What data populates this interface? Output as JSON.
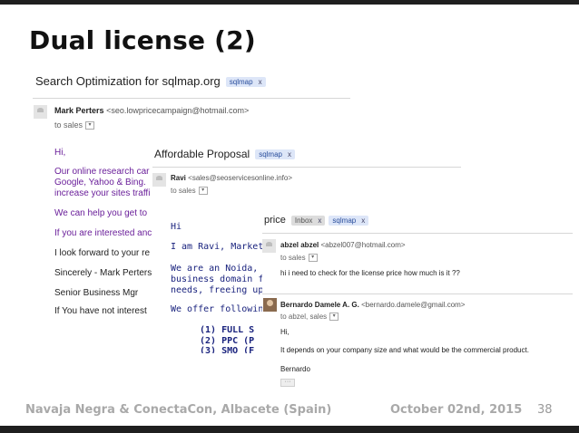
{
  "slide": {
    "title": "Dual license (2)",
    "footer_left": "Navaja Negra & ConectaCon, Albacete (Spain)",
    "footer_date": "October 02nd, 2015",
    "page_number": "38"
  },
  "email1": {
    "subject": "Search Optimization for sqlmap.org",
    "label": "sqlmap",
    "label_close": "x",
    "sender_name": "Mark Perters",
    "sender_email": "<seo.lowpricecampaign@hotmail.com>",
    "to": "to sales",
    "lines": [
      "Hi,",
      "Our online research car",
      "Google, Yahoo & Bing.",
      "increase your sites traffi",
      "We can help you get to",
      "If you are interested anc",
      "I look forward to your re",
      "Sincerely - Mark Perters",
      "Senior Business Mgr",
      "If You have not interest"
    ]
  },
  "email2": {
    "subject": "Affordable Proposal",
    "label": "sqlmap",
    "label_close": "x",
    "sender_name": "Ravi",
    "sender_email": "<sales@seoservicesonline.info>",
    "to": "to sales",
    "lines": [
      "Hi",
      "I am Ravi, Marketing",
      "We are an Noida, Ir",
      "business domain fr",
      "needs, freeing up yc",
      "We offer following S",
      "(1)   FULL S",
      "(2)   PPC (P",
      "(3)   SMO (F"
    ]
  },
  "email3": {
    "subject": "price",
    "labels": [
      {
        "text": "Inbox",
        "close": "x"
      },
      {
        "text": "sqlmap",
        "close": "x"
      }
    ],
    "message1": {
      "sender_name": "abzel abzel",
      "sender_email": "<abzel007@hotmail.com>",
      "to": "to sales",
      "body": "hi i need to check for the license price how much is it ??"
    },
    "message2": {
      "sender_name": "Bernardo Damele A. G.",
      "sender_email": "<bernardo.damele@gmail.com>",
      "to": "to abzel, sales",
      "lines": [
        "Hi,",
        "It depends on your company size and what would be the commercial product.",
        "Bernardo"
      ],
      "ellipsis": "···"
    }
  },
  "icons": {
    "dropdown": "▾"
  }
}
